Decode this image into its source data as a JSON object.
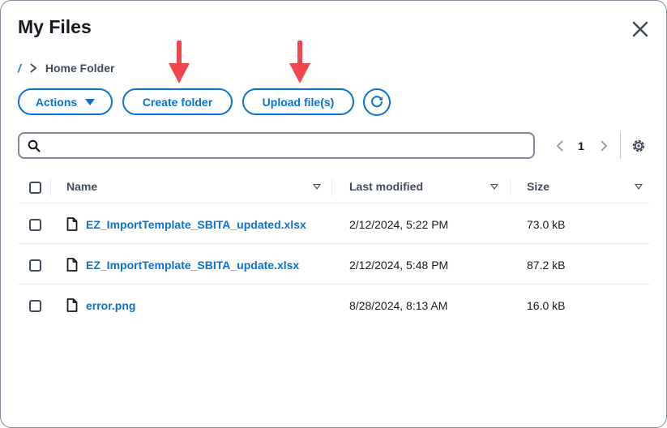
{
  "dialog": {
    "title": "My Files",
    "close_icon": "close-icon"
  },
  "breadcrumb": {
    "root": "/",
    "separator_icon": "chevron-right-icon",
    "current": "Home Folder"
  },
  "toolbar": {
    "actions_label": "Actions",
    "create_folder_label": "Create folder",
    "upload_label": "Upload file(s)",
    "refresh_icon": "refresh-icon"
  },
  "annotations": {
    "arrow_color": "#f0474d",
    "arrow_icon": "red-down-arrow"
  },
  "search": {
    "value": "",
    "placeholder": "",
    "icon": "search-icon"
  },
  "pagination": {
    "current_page": "1",
    "prev_icon": "chevron-left-icon",
    "next_icon": "chevron-right-icon",
    "settings_icon": "gear-icon"
  },
  "table": {
    "columns": [
      "Name",
      "Last modified",
      "Size"
    ],
    "rows": [
      {
        "name": "EZ_ImportTemplate_SBITA_updated.xlsx",
        "modified": "2/12/2024, 5:22 PM",
        "size": "73.0 kB"
      },
      {
        "name": "EZ_ImportTemplate_SBITA_update.xlsx",
        "modified": "2/12/2024, 5:48 PM",
        "size": "87.2 kB"
      },
      {
        "name": "error.png",
        "modified": "8/28/2024, 8:13 AM",
        "size": "16.0 kB"
      }
    ]
  },
  "colors": {
    "accent": "#0972d3",
    "text": "#16191f",
    "muted": "#414d5c",
    "border": "#7d8998"
  }
}
